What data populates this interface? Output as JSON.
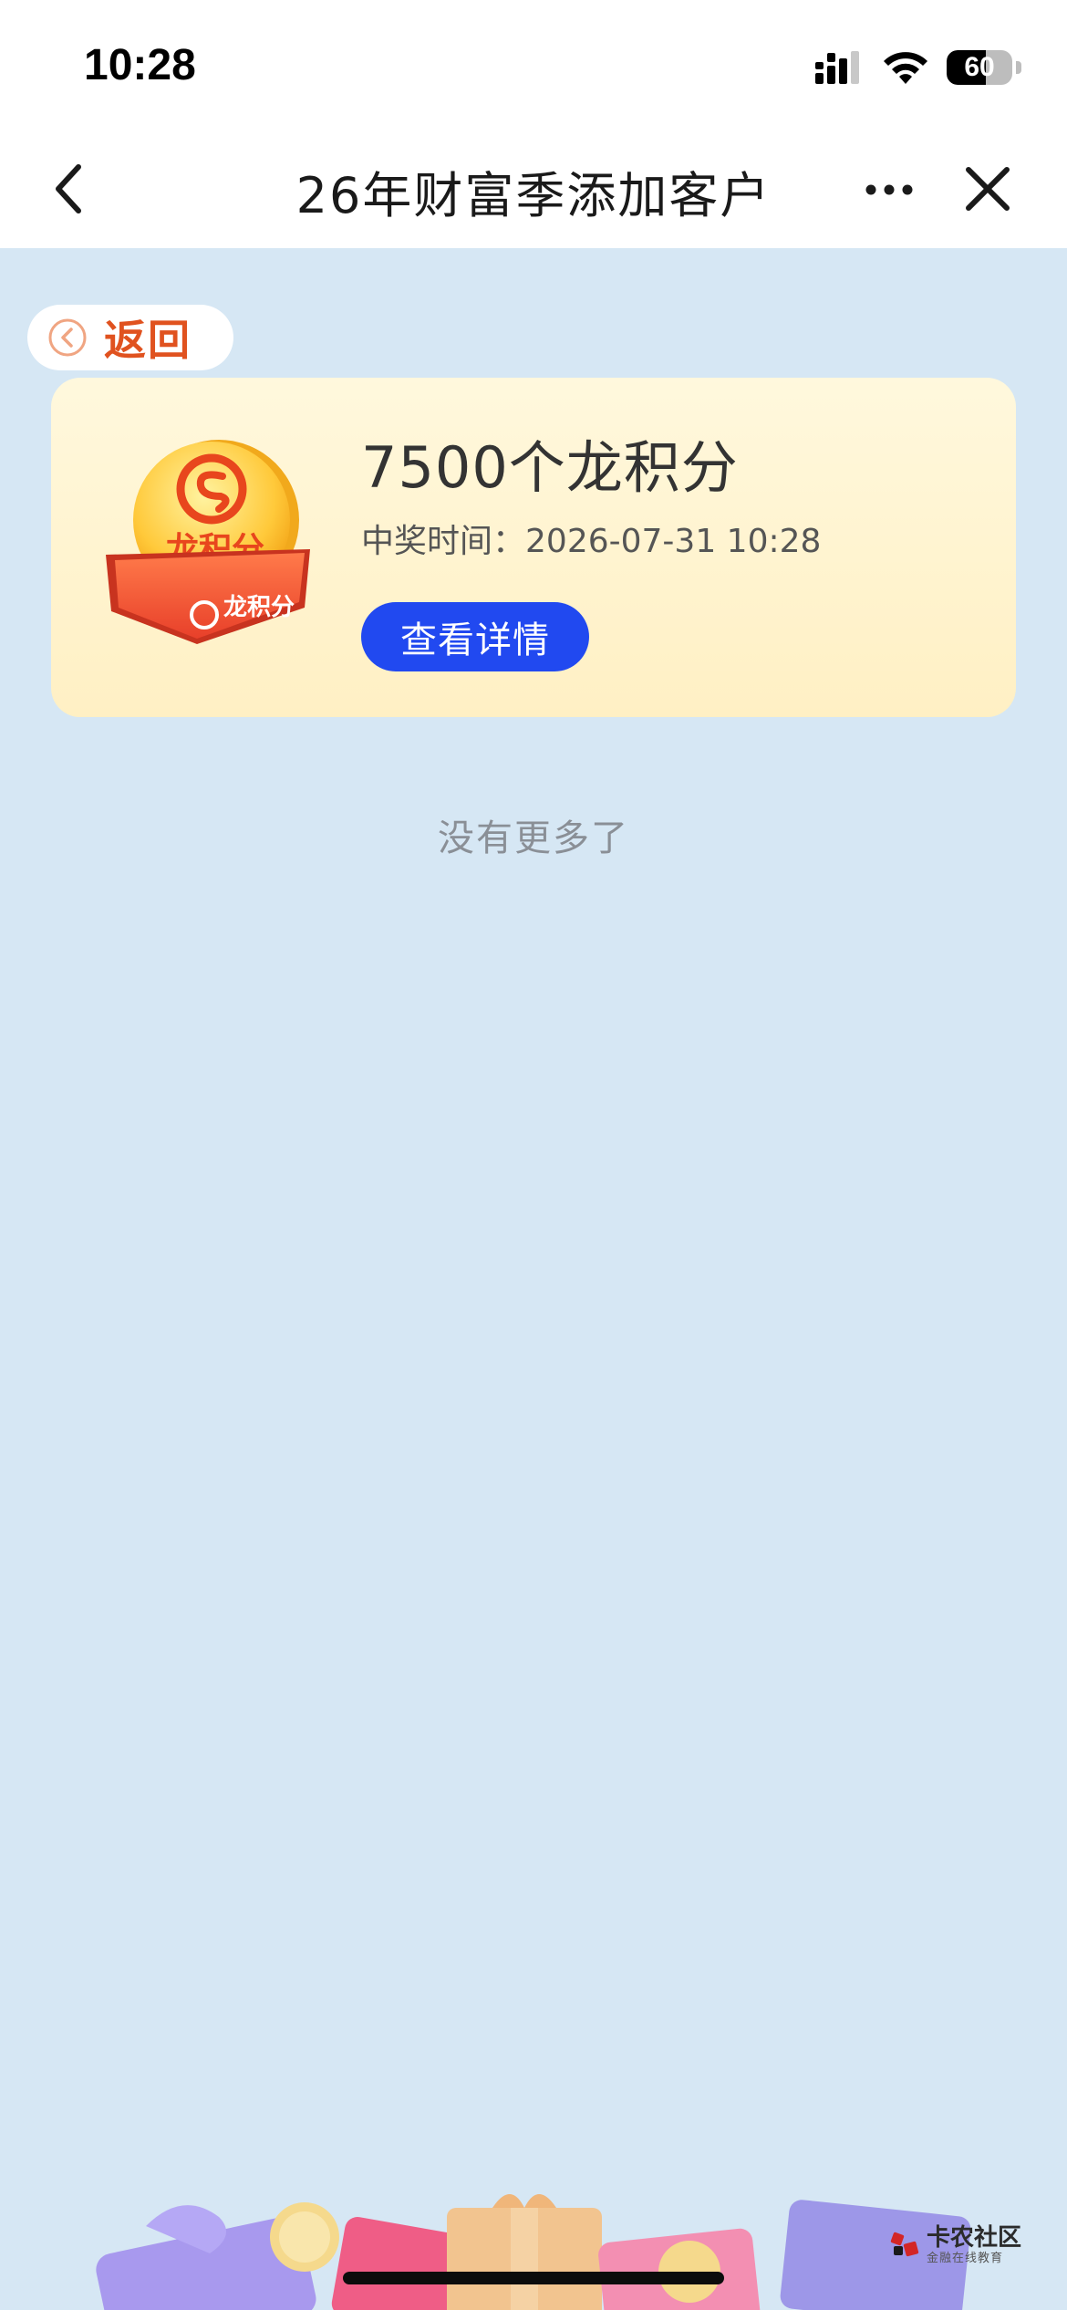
{
  "status_bar": {
    "time": "10:28",
    "battery": "60",
    "battery_level": 0.6,
    "icons": [
      "cellular-signal-icon",
      "wifi-icon",
      "battery-icon"
    ]
  },
  "nav": {
    "title": "26年财富季添加客户",
    "back_icon": "chevron-left-icon",
    "more_icon": "more-dots-icon",
    "close_icon": "close-icon"
  },
  "return_button": {
    "label": "返回",
    "icon": "circle-chevron-left-icon",
    "color": "#e0521f"
  },
  "prize": {
    "title": "7500个龙积分",
    "time_label": "中奖时间：",
    "time_value": "2026-07-31 10:28",
    "button_label": "查看详情",
    "image_text_top": "龙积分",
    "image_text_box": "龙积分",
    "button_color": "#2149f0"
  },
  "footer": {
    "no_more": "没有更多了",
    "watermark_main": "卡农社区",
    "watermark_sub": "金融在线教育"
  },
  "colors": {
    "page_background": "#d6e7f4",
    "card_background": "#fff4d2"
  }
}
